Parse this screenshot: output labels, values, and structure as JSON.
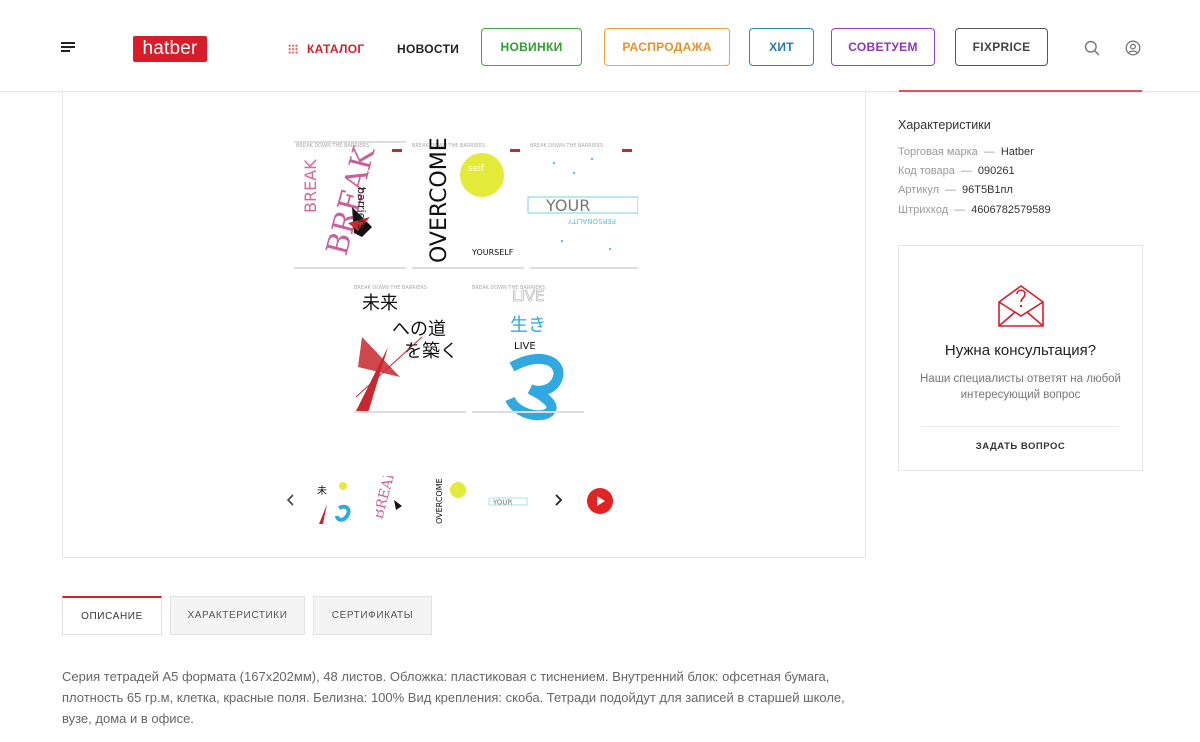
{
  "header": {
    "logo_text": "hatber",
    "nav": {
      "catalog": "КАТАЛОГ",
      "news": "НОВОСТИ"
    },
    "pills": {
      "new": "НОВИНКИ",
      "sale": "РАСПРОДАЖА",
      "hit": "ХИТ",
      "advise": "СОВЕТУЕМ",
      "fixprice": "FIXPRICE"
    }
  },
  "product": {
    "main_image_alt": "Тетради A5 серии Break down the barriers",
    "thumbnails": [
      "thumb-1",
      "thumb-2",
      "thumb-3",
      "thumb-4"
    ]
  },
  "characteristics": {
    "title": "Характеристики",
    "rows": [
      {
        "label": "Торговая марка",
        "value": "Hatber"
      },
      {
        "label": "Код товара",
        "value": "090261"
      },
      {
        "label": "Артикул",
        "value": "96Т5В1пл"
      },
      {
        "label": "Штрихкод",
        "value": "4606782579589"
      }
    ]
  },
  "consultation": {
    "title": "Нужна консультация?",
    "text": "Наши специалисты ответят на любой интересующий вопрос",
    "button": "ЗАДАТЬ ВОПРОС"
  },
  "tabs": [
    {
      "label": "ОПИСАНИЕ",
      "active": true
    },
    {
      "label": "ХАРАКТЕРИСТИКИ",
      "active": false
    },
    {
      "label": "СЕРТИФИКАТЫ",
      "active": false
    }
  ],
  "description": "Серия  тетрадей А5 формата (167х202мм), 48 листов. Обложка: пластиковая с тиснением.  Внутренний блок: офсетная бумага, плотность  65 гр.м, клетка, красные поля. Белизна: 100% Вид крепления: скоба. Тетради подойдут для записей в старшей школе, вузе, дома и в офисе.",
  "colors": {
    "brand_red": "#d91c2a",
    "green": "#2e9e2e",
    "orange": "#e7922c",
    "blue": "#2678b5",
    "purple": "#8e34bd"
  },
  "icons": {
    "menu": "burger-menu-icon",
    "search": "search-icon",
    "user": "user-icon",
    "envelope": "envelope-question-icon",
    "prev": "chevron-left-icon",
    "next": "chevron-right-icon",
    "play": "play-icon"
  }
}
